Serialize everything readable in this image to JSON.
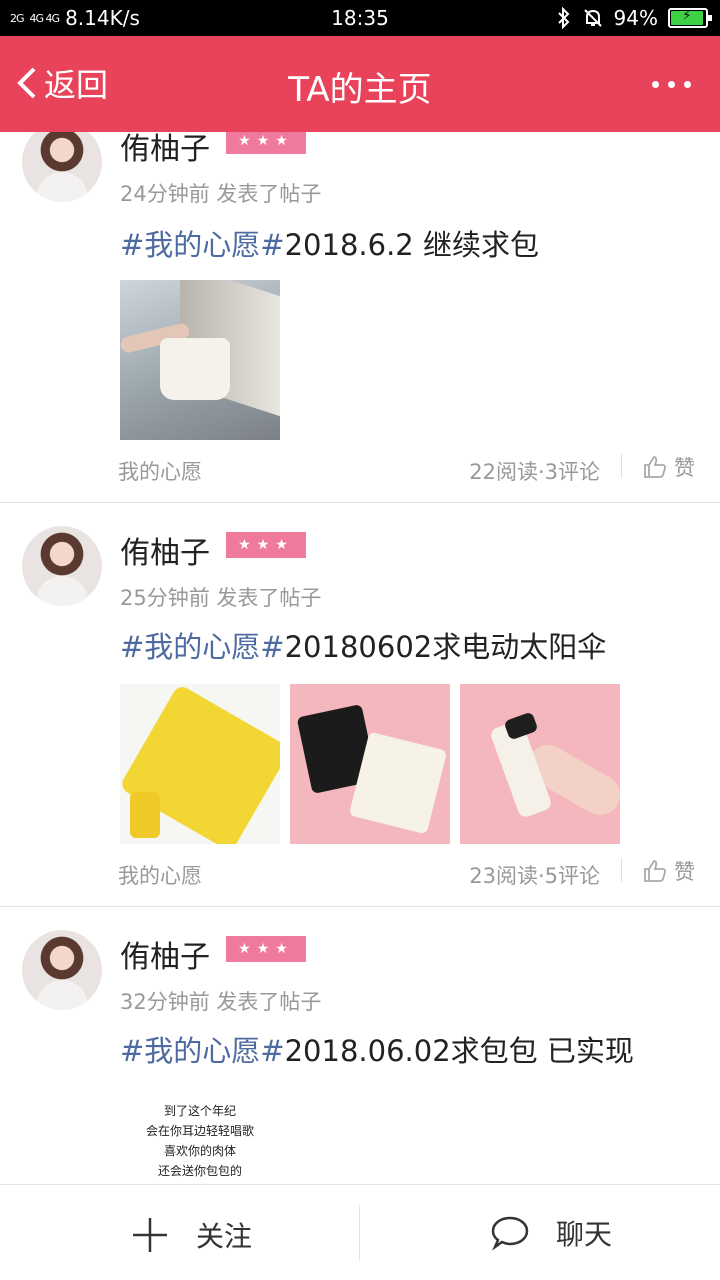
{
  "status_bar": {
    "network_left": "2G",
    "network_right": "4G 4G",
    "speed": "8.14K/s",
    "time": "18:35",
    "battery": "94%",
    "battery_level": 0.94,
    "icons": [
      "bluetooth-icon",
      "bell-muted-icon",
      "battery-icon"
    ]
  },
  "nav": {
    "back_label": "返回",
    "title": "TA的主页",
    "more_icon": "more-dots-icon"
  },
  "posts": [
    {
      "username": "侑柚子",
      "level_stars": "★★★",
      "meta": "24分钟前  发表了帖子",
      "tag": "#我的心愿#",
      "text": "2018.6.2  继续求包",
      "category": "我的心愿",
      "stats": "22阅读·3评论",
      "like_label": "赞"
    },
    {
      "username": "侑柚子",
      "level_stars": "★★★",
      "meta": "25分钟前  发表了帖子",
      "tag": "#我的心愿#",
      "text": "20180602求电动太阳伞",
      "category": "我的心愿",
      "stats": "23阅读·5评论",
      "like_label": "赞"
    },
    {
      "username": "侑柚子",
      "level_stars": "★★★",
      "meta": "32分钟前  发表了帖子",
      "tag": "#我的心愿#",
      "text": "2018.06.02求包包 已实现",
      "image_text": [
        "到了这个年纪",
        "会在你耳边轻轻唱歌",
        "喜欢你的肉体",
        "还会送你包包的"
      ]
    }
  ],
  "bottom_bar": {
    "follow_label": "关注",
    "chat_label": "聊天"
  },
  "colors": {
    "brand": "#e8435a",
    "badge": "#f07a9c",
    "tag": "#4d6aa1"
  }
}
